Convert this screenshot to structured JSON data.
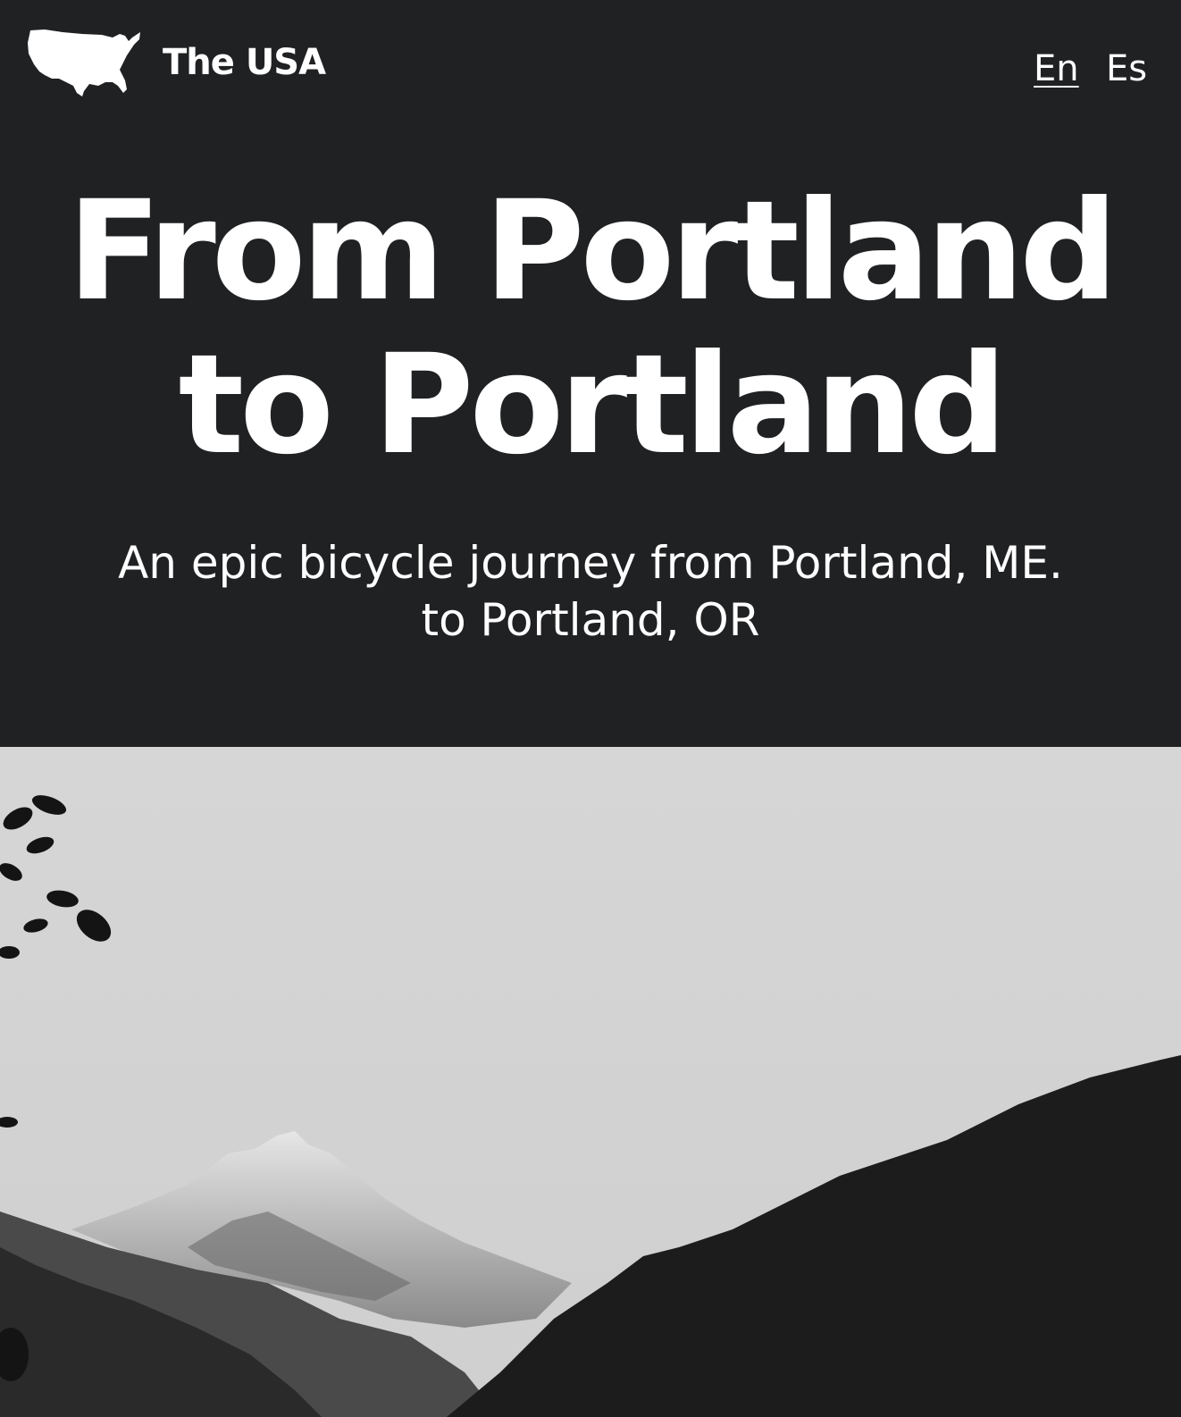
{
  "header": {
    "logo_icon": "usa-map-icon",
    "brand": "The USA",
    "languages": [
      {
        "label": "En",
        "active": true
      },
      {
        "label": "Es",
        "active": false
      }
    ]
  },
  "hero": {
    "title_line1": "From Portland",
    "title_line2": "to Portland",
    "subtitle_line1": "An epic bicycle journey from Portland, ME.",
    "subtitle_line2": "to Portland, OR"
  },
  "photo": {
    "icon": "mountain-landscape-photo"
  },
  "colors": {
    "background": "#202123",
    "text": "#ffffff",
    "sky": "#d4d4d4"
  }
}
